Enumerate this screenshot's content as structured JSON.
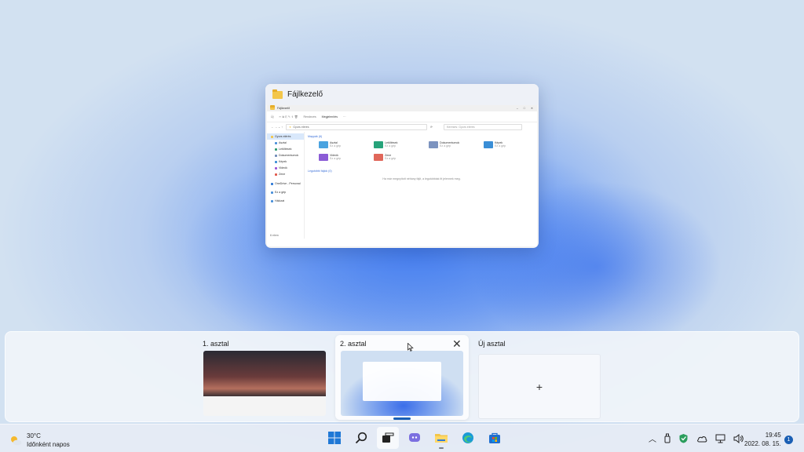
{
  "window_preview": {
    "title": "Fájlkezelő",
    "explorer": {
      "tab_title": "Fájlkezelő",
      "toolbar": [
        "Új",
        "Rendezés",
        "Megjelenítés"
      ],
      "address": "Gyors elérés",
      "search_placeholder": "Keresés: Gyors elérés",
      "nav_items": [
        {
          "label": "Gyors elérés",
          "color": "#f3c64a",
          "selected": true
        },
        {
          "label": "Asztal",
          "color": "#4a90d9"
        },
        {
          "label": "Letöltések",
          "color": "#2e9b6e"
        },
        {
          "label": "Dokumentumok",
          "color": "#6f8bb8"
        },
        {
          "label": "Képek",
          "color": "#3a8ed6"
        },
        {
          "label": "Videók",
          "color": "#9b55d6"
        },
        {
          "label": "Zene",
          "color": "#e0574a"
        },
        {
          "label": "OneDrive - Personal",
          "color": "#2f7ad6"
        },
        {
          "label": "Ez a gép",
          "color": "#4a90d9"
        },
        {
          "label": "Hálózat",
          "color": "#4a90d9"
        }
      ],
      "section_frequent": "Mappák (6)",
      "folders": [
        {
          "name": "Asztal",
          "sub": "Ez a gép",
          "color": "#4aa3e0"
        },
        {
          "name": "Letöltések",
          "sub": "Ez a gép",
          "color": "#27a37a"
        },
        {
          "name": "Dokumentumok",
          "sub": "Ez a gép",
          "color": "#7c93bf"
        },
        {
          "name": "Képek",
          "sub": "Ez a gép",
          "color": "#3a8ed6"
        },
        {
          "name": "Videók",
          "sub": "Ez a gép",
          "color": "#8b5cd6"
        },
        {
          "name": "Zene",
          "sub": "Ez a gép",
          "color": "#e0675a"
        }
      ],
      "section_recent": "Legutóbbi fájlok (0)",
      "empty_message": "Ha már megnyitott néhány fájlt, a legutóbbiak itt jelennek meg.",
      "status": "6 elem"
    }
  },
  "switcher": {
    "desktops": [
      {
        "label": "1. asztal"
      },
      {
        "label": "2. asztal",
        "close": "✕"
      },
      {
        "label": "Új asztal",
        "add": "+"
      }
    ]
  },
  "taskbar": {
    "weather_temp": "30°C",
    "weather_desc": "Időnként napos",
    "time": "19:45",
    "date": "2022. 08. 15.",
    "notification_count": "1"
  }
}
